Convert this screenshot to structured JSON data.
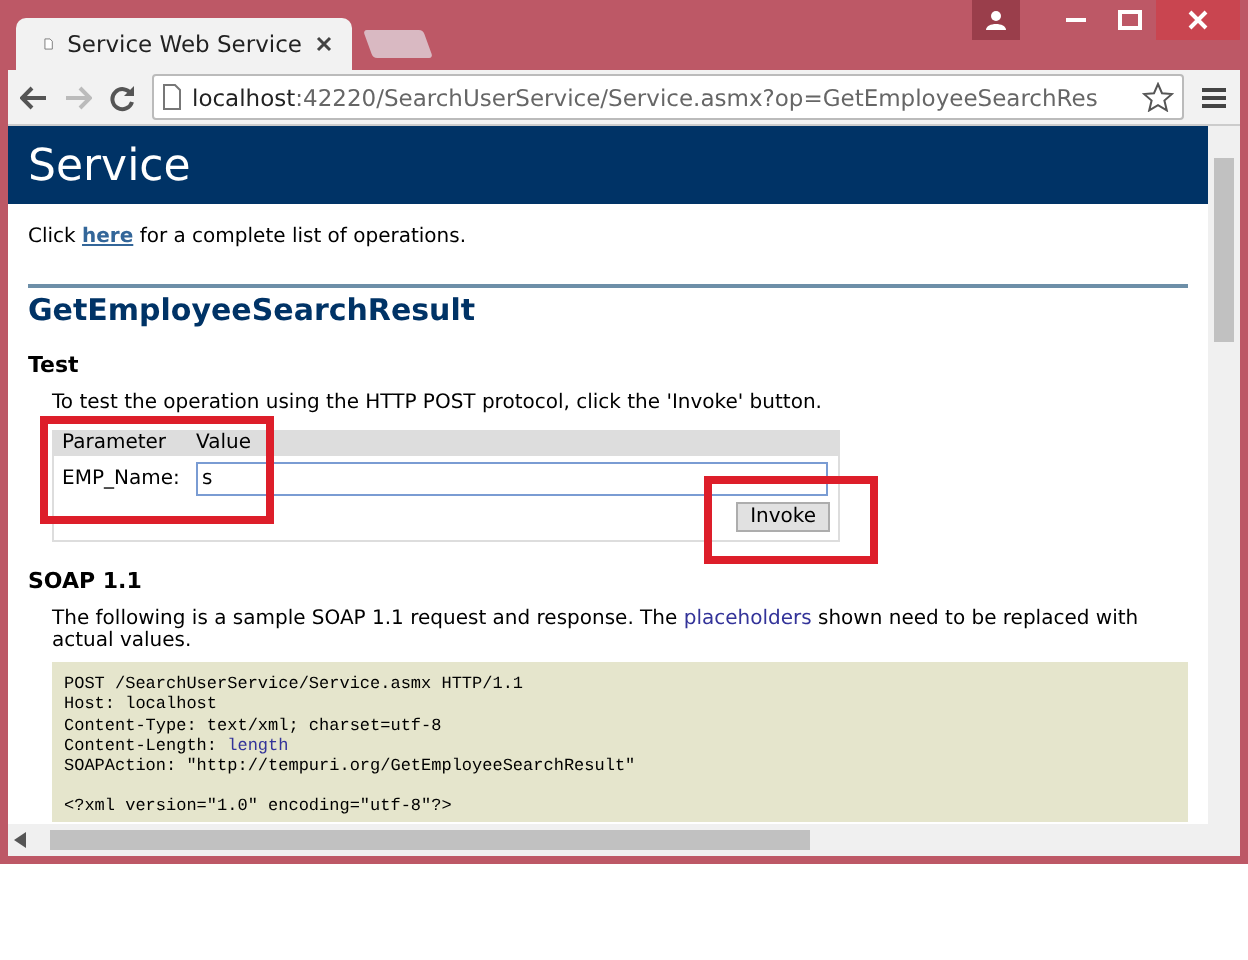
{
  "browser": {
    "tabs": [
      {
        "title": "Service Web Service",
        "selected": true
      },
      {
        "selected": false
      }
    ],
    "address": {
      "host": "localhost",
      "path": ":42220/SearchUserService/Service.asmx?op=GetEmployeeSearchRes"
    }
  },
  "page": {
    "header": "Service",
    "intro": {
      "before": "Click ",
      "link": "here",
      "after": " for a complete list of operations."
    },
    "operation": "GetEmployeeSearchResult",
    "test": {
      "heading": "Test",
      "text": "To test the operation using the HTTP POST protocol, click the 'Invoke' button.",
      "columns": [
        "Parameter",
        "Value"
      ],
      "params": [
        {
          "name": "EMP_Name:",
          "value": "s"
        }
      ],
      "button": "Invoke"
    },
    "soap": {
      "heading": "SOAP 1.1",
      "before": "The following is a sample SOAP 1.1 request and response. The ",
      "highlight": "placeholders",
      "after": " shown need to be replaced with actual values.",
      "blocks": [
        [
          {
            "text": "POST /SearchUserService/Service.asmx HTTP/1.1"
          },
          {
            "text": "Host: localhost"
          },
          {
            "text": "Content-Type: text/xml; charset=utf-8"
          },
          {
            "text": "Content-Length: ",
            "placeholder": "length"
          },
          {
            "text": "SOAPAction: \"http://tempuri.org/GetEmployeeSearchResult\""
          }
        ],
        [
          {
            "text": "<?xml version=\"1.0\" encoding=\"utf-8\"?>"
          }
        ]
      ]
    }
  },
  "annotations": [
    {
      "kind": "frame"
    },
    {
      "kind": "frame"
    }
  ]
}
